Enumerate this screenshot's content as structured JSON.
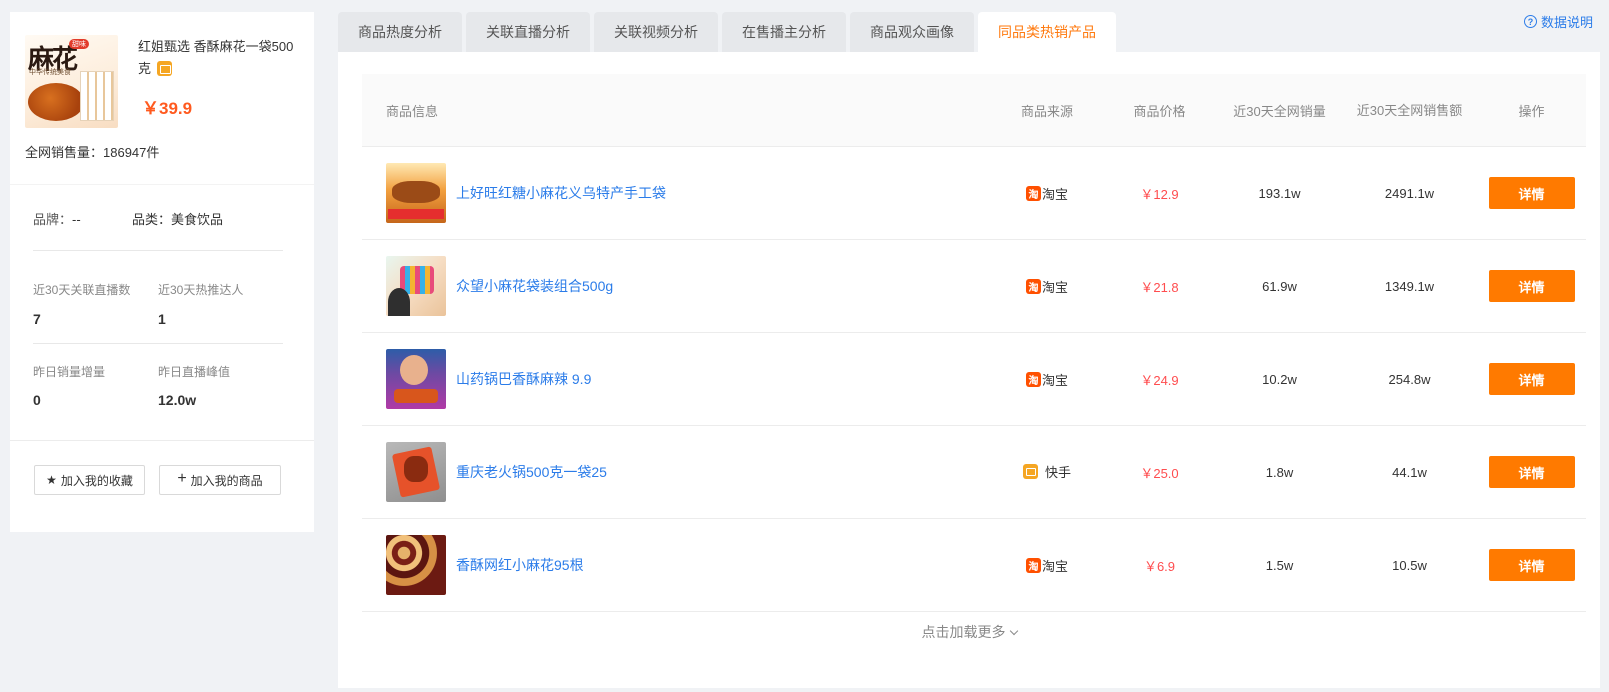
{
  "product": {
    "title": "红姐甄选 香酥麻花一袋500克",
    "price": "￥39.9",
    "sales_label": "全网销售量：",
    "sales_value": "186947件",
    "thumb_text": "麻花",
    "thumb_tag": "甜味",
    "thumb_small": "中华传统美食"
  },
  "meta": {
    "brand_label": "品牌：",
    "brand_value": "--",
    "category_label": "品类：",
    "category_value": "美食饮品"
  },
  "stats": [
    {
      "label": "近30天关联直播数",
      "value": "7"
    },
    {
      "label": "近30天热推达人",
      "value": "1"
    },
    {
      "label": "昨日销量增量",
      "value": "0"
    },
    {
      "label": "昨日直播峰值",
      "value": "12.0w"
    }
  ],
  "actions": {
    "favorite": "加入我的收藏",
    "add_product": "加入我的商品"
  },
  "tabs": [
    {
      "label": "商品热度分析"
    },
    {
      "label": "关联直播分析"
    },
    {
      "label": "关联视频分析"
    },
    {
      "label": "在售播主分析"
    },
    {
      "label": "商品观众画像"
    },
    {
      "label": "同品类热销产品"
    }
  ],
  "active_tab": 5,
  "help_label": "数据说明",
  "table": {
    "headers": {
      "info": "商品信息",
      "source": "商品来源",
      "price": "商品价格",
      "volume": "近30天全网销量",
      "amount": "近30天全网销售额",
      "op": "操作"
    },
    "rows": [
      {
        "name": "上好旺红糖小麻花义乌特产手工袋",
        "source": "淘宝",
        "source_type": "taobao",
        "price": "￥12.9",
        "volume": "193.1w",
        "amount": "2491.1w",
        "op": "详情"
      },
      {
        "name": "众望小麻花袋装组合500g",
        "source": "淘宝",
        "source_type": "taobao",
        "price": "￥21.8",
        "volume": "61.9w",
        "amount": "1349.1w",
        "op": "详情"
      },
      {
        "name": "山药锅巴香酥麻辣 9.9",
        "source": "淘宝",
        "source_type": "taobao",
        "price": "￥24.9",
        "volume": "10.2w",
        "amount": "254.8w",
        "op": "详情"
      },
      {
        "name": "重庆老火锅500克一袋25",
        "source": "快手",
        "source_type": "kuaishou",
        "price": "￥25.0",
        "volume": "1.8w",
        "amount": "44.1w",
        "op": "详情"
      },
      {
        "name": "香酥网红小麻花95根",
        "source": "淘宝",
        "source_type": "taobao",
        "price": "￥6.9",
        "volume": "1.5w",
        "amount": "10.5w",
        "op": "详情"
      }
    ],
    "taobao_glyph": "淘"
  },
  "load_more": "点击加载更多",
  "colors": {
    "accent": "#ff7a00",
    "link": "#2b7ce9",
    "price": "#ff4d4f",
    "background": "#f0f2f5"
  }
}
